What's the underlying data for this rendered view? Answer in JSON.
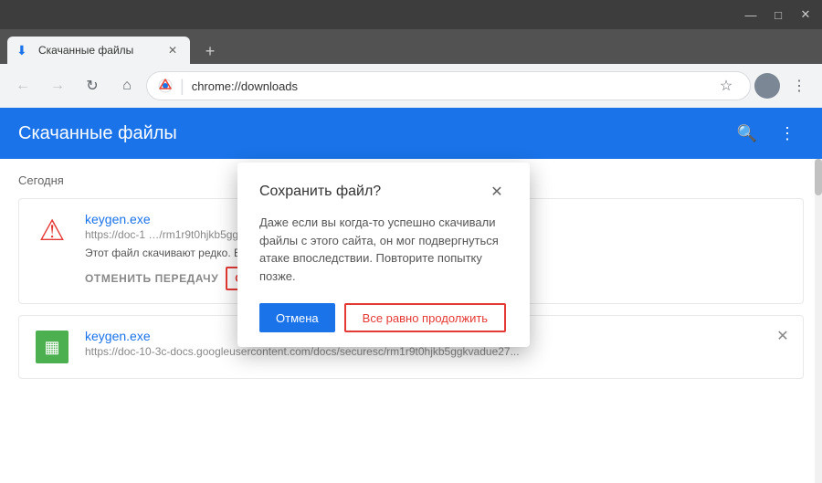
{
  "window": {
    "title_bar": {
      "minimize": "—",
      "maximize": "□",
      "close": "✕"
    }
  },
  "tab": {
    "favicon": "⬇",
    "title": "Скачанные файлы",
    "close": "✕",
    "new_tab": "+"
  },
  "navbar": {
    "back": "←",
    "forward": "→",
    "refresh": "↻",
    "home": "⌂",
    "brand": "Chrome",
    "url": "chrome://downloads",
    "star": "☆",
    "menu": "⋮"
  },
  "downloads_page": {
    "title": "Скачанные файлы",
    "search_icon": "🔍",
    "menu_icon": "⋮"
  },
  "content": {
    "today_label": "Сегодня",
    "items": [
      {
        "name": "keygen.exe",
        "url": "https://doc-1",
        "url_full": "https://doc-10-3c-docs.googleusercontent.com/docs/securesc/rm1r9t0hjkb5ggkvadue27...",
        "warning": "Этот файл скачивают редко. Возможно, он вредоносный.",
        "action_cancel": "ОТМЕНИТЬ ПЕРЕДАЧУ",
        "action_save": "СОХРАНИТЬ",
        "has_warning": true
      },
      {
        "name": "keygen.exe",
        "url_full": "https://doc-10-3c-docs.googleusercontent.com/docs/securesc/rm1r9t0hjkb5ggkvadue27...",
        "has_warning": false
      }
    ]
  },
  "dialog": {
    "title": "Сохранить файл?",
    "close": "✕",
    "body": "Даже если вы когда-то успешно скачивали файлы с этого сайта, он мог подвергнуться атаке впоследствии. Повторите попытку позже.",
    "cancel_label": "Отмена",
    "continue_label": "Все равно продолжить"
  }
}
